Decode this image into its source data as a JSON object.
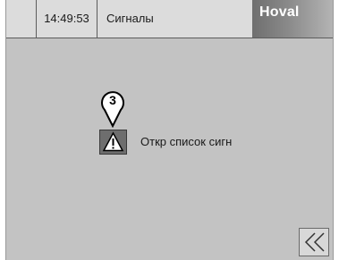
{
  "header": {
    "time": "14:49:53",
    "title": "Сигналы",
    "brand": "Hoval"
  },
  "callout": {
    "number": "3"
  },
  "message": {
    "icon": "warning-triangle-icon",
    "text": "Откр список сигн"
  },
  "navigation": {
    "back_icon": "double-chevron-left-icon"
  }
}
